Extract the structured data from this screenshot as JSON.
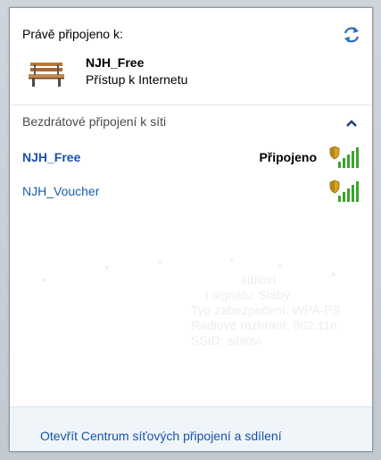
{
  "header": {
    "connected_to_label": "Právě připojeno k:"
  },
  "current_connection": {
    "name": "NJH_Free",
    "status": "Přístup k Internetu",
    "icon": "bench-network-icon"
  },
  "wireless_section": {
    "title": "Bezdrátové připojení k síti",
    "collapse_icon": "chevron-up-icon"
  },
  "networks": [
    {
      "name": "NJH_Free",
      "state": "Připojeno",
      "secured": true,
      "signal": "full",
      "active": true
    },
    {
      "name": "NJH_Voucher",
      "state": "",
      "secured": true,
      "signal": "full",
      "active": false
    }
  ],
  "ghost_tooltip": {
    "lines": [
      "sibiovi",
      "í signálu: Slabý",
      "Typ zabezpečení: WPA-PS",
      "Rádiové rozhraní: 802.11n",
      "SSID: sibiovi"
    ]
  },
  "footer": {
    "link_label": "Otevřít Centrum síťových připojení a sdílení"
  },
  "colors": {
    "link": "#1652a8",
    "signal_green": "#3aa52a",
    "shield_gold": "#d9a21b"
  }
}
